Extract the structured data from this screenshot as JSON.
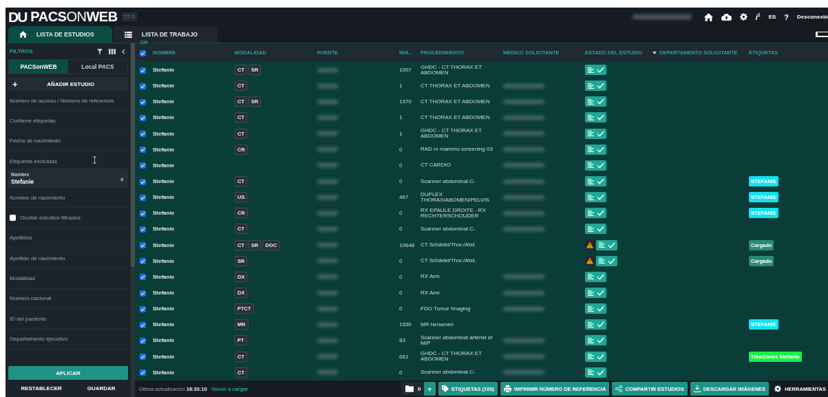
{
  "header": {
    "logo_mark": "DU",
    "logo": [
      {
        "text": "PACS",
        "light": false
      },
      {
        "text": "ON",
        "light": true
      },
      {
        "text": "WEB",
        "light": false
      }
    ],
    "badge": "TT 0",
    "user_redacted": true,
    "info": "i",
    "info_count": "1",
    "language": "ES",
    "help": "?",
    "logout": "Desconexió"
  },
  "tabs": [
    {
      "label": "LISTA DE ESTUDIOS",
      "selected": true
    },
    {
      "label": "LISTA DE TRABAJO",
      "selected": false
    }
  ],
  "sidebar": {
    "title": "FILTROS",
    "sources": [
      {
        "label": "PACSonWEB",
        "selected": true
      },
      {
        "label": "Local PACS",
        "selected": false
      }
    ],
    "add_plus": "+",
    "add_study": "AÑADIR ESTUDIO",
    "filters": [
      {
        "kind": "field",
        "placeholder": "Número de acceso / Número de referencia"
      },
      {
        "kind": "field",
        "placeholder": "Contiene etiquetas"
      },
      {
        "kind": "field",
        "placeholder": "Fecha de nacimiento"
      },
      {
        "kind": "field",
        "placeholder": "Etiquetas excluidas"
      },
      {
        "kind": "filled",
        "label": "Nombre",
        "value": "Stefanie",
        "clear": "×"
      },
      {
        "kind": "field",
        "placeholder": "Nombre de nacimiento"
      },
      {
        "kind": "checkbox",
        "label": "Ocultar estudios filtrados",
        "checked": false
      },
      {
        "kind": "field",
        "placeholder": "Apellidos"
      },
      {
        "kind": "field",
        "placeholder": "Apellido de nacimiento"
      },
      {
        "kind": "field",
        "placeholder": "Modalidad"
      },
      {
        "kind": "field",
        "placeholder": "Número nacional"
      },
      {
        "kind": "field",
        "placeholder": "ID del paciente"
      },
      {
        "kind": "field",
        "placeholder": "Departamento ejecutivo"
      }
    ],
    "apply": "APLICAR",
    "reset": "RESTABLECER",
    "save": "GUARDAR"
  },
  "table": {
    "select_all": {
      "checked": true,
      "count": "100"
    },
    "columns": [
      {
        "label": "NOMBRE",
        "sorted": false
      },
      {
        "label": "MODALIDAD",
        "sorted": false
      },
      {
        "label": "FUENTE",
        "sorted": false
      },
      {
        "label": "IMÁ...",
        "sorted": false
      },
      {
        "label": "PROCEDIMIENTO",
        "sorted": false
      },
      {
        "label": "MÉDICO SOLICITANTE",
        "sorted": false
      },
      {
        "label": "ESTADO DEL ESTUDIO",
        "sorted": false
      },
      {
        "label": "DEPARTAMENTO SOLICITANTE",
        "sorted": true
      },
      {
        "label": "ETIQUETAS",
        "sorted": false
      }
    ],
    "rows": [
      {
        "checked": true,
        "name": "Stefanie",
        "modalities": [
          "CT",
          "SR"
        ],
        "images": "1007",
        "procedure": "GHDC - CT THORAX ET ABDOMEN"
      },
      {
        "checked": true,
        "name": "Stefanie",
        "modalities": [
          "CT"
        ],
        "images": "1",
        "procedure": "CT THORAX ET ABDOMEN",
        "physician_redacted": true
      },
      {
        "checked": true,
        "name": "Stefanie",
        "modalities": [
          "CT",
          "SR"
        ],
        "images": "1370",
        "procedure": "CT THORAX ET ABDOMEN",
        "physician_redacted": true
      },
      {
        "checked": true,
        "name": "Stefanie",
        "modalities": [
          "CT"
        ],
        "images": "1",
        "procedure": "CT THORAX ET ABDOMEN",
        "physician_redacted": true
      },
      {
        "checked": true,
        "name": "Stefanie",
        "modalities": [
          "CT"
        ],
        "images": "1",
        "procedure": "GHDC - CT THORAX ET ABDOMEN",
        "physician_redacted": true
      },
      {
        "checked": true,
        "name": "Stefanie",
        "modalities": [
          "CR"
        ],
        "images": "0",
        "procedure": "RAD rx mammo screening 03",
        "physician_redacted": true
      },
      {
        "checked": true,
        "name": "Stefanie",
        "images": "0",
        "procedure": "CT CARDIO",
        "physician_redacted": true
      },
      {
        "checked": true,
        "name": "Stefanie",
        "modalities": [
          "CT"
        ],
        "images": "0",
        "procedure": "Scanner abdominal C-",
        "physician_redacted": true,
        "tag": {
          "label": "STEFANIE",
          "color": "#14e0f0"
        }
      },
      {
        "checked": true,
        "name": "Stefanie",
        "modalities": [
          "US"
        ],
        "images": "467",
        "procedure": "DUPLEX THORAX/ABOMEN/PELVIS",
        "physician_redacted": true,
        "tag": {
          "label": "STEFANIE",
          "color": "#14e0f0"
        }
      },
      {
        "checked": true,
        "name": "Stefanie",
        "modalities": [
          "CR"
        ],
        "images": "0",
        "procedure": "RX EPAULE DROITE - RX RECHTERSCHOUDER",
        "physician_redacted": true,
        "tag": {
          "label": "STEFANIE",
          "color": "#14e0f0"
        }
      },
      {
        "checked": true,
        "name": "Stefanie",
        "modalities": [
          "CT"
        ],
        "images": "0",
        "procedure": "Scanner abdominal C-",
        "physician_redacted": true
      },
      {
        "checked": true,
        "name": "Stefanie",
        "modalities": [
          "CT",
          "SR",
          "DOC"
        ],
        "images": "10648",
        "procedure": "CT Schädel/Thor./Abd.",
        "warning": true,
        "tag": {
          "label": "Cargado",
          "color": "#2a8a78"
        }
      },
      {
        "checked": true,
        "name": "Stefanie",
        "modalities": [
          "SR"
        ],
        "images": "0",
        "procedure": "CT Schädel/Thor./Abd.",
        "warning": true,
        "tag": {
          "label": "Cargado",
          "color": "#2a8a78"
        }
      },
      {
        "checked": true,
        "name": "Stefanie",
        "modalities": [
          "DX"
        ],
        "images": "0",
        "procedure": "RX Arm",
        "physician_redacted": true
      },
      {
        "checked": true,
        "name": "Stefanie",
        "modalities": [
          "DX"
        ],
        "images": "0",
        "procedure": "RX Arm",
        "physician_redacted": true
      },
      {
        "checked": true,
        "name": "Stefanie",
        "modalities": [
          "PTCT"
        ],
        "images": "0",
        "procedure": "FDG Tumor Imaging",
        "physician_redacted": true
      },
      {
        "checked": true,
        "name": "Stefanie",
        "modalities": [
          "MR"
        ],
        "images": "1550",
        "procedure": "MR hersenen",
        "tag": {
          "label": "STEFANIE",
          "color": "#14e0f0"
        }
      },
      {
        "checked": true,
        "name": "Stefanie",
        "modalities": [
          "PT"
        ],
        "images": "83",
        "procedure": "Scanner abdominal artériel et MIP",
        "physician_redacted": true
      },
      {
        "checked": true,
        "name": "Stefanie",
        "modalities": [
          "CT"
        ],
        "images": "661",
        "procedure": "GHDC - CT THORAX ET ABDOMEN",
        "physician_redacted": true,
        "tag": {
          "label": "TimeZones Stefanie",
          "color": "#19f04a"
        }
      },
      {
        "checked": true,
        "name": "Stefanie",
        "modalities": [
          "CT"
        ],
        "images": "0",
        "procedure": "Scanner abdominal C-",
        "physician_redacted": true
      }
    ]
  },
  "footer": {
    "updated": "Última actualización **16:30:10**",
    "reload": "Volver a cargar",
    "folder_count": "0",
    "add": "+",
    "buttons": [
      {
        "label": "ETIQUETAS (100)"
      },
      {
        "label": "IMPRIMIR NÚMERO DE REFERENCIA"
      },
      {
        "label": "COMPARTIR ESTUDIOS"
      },
      {
        "label": "DESCARGAR IMÁGENES"
      }
    ],
    "tools": "HERRAMIENTAS"
  }
}
